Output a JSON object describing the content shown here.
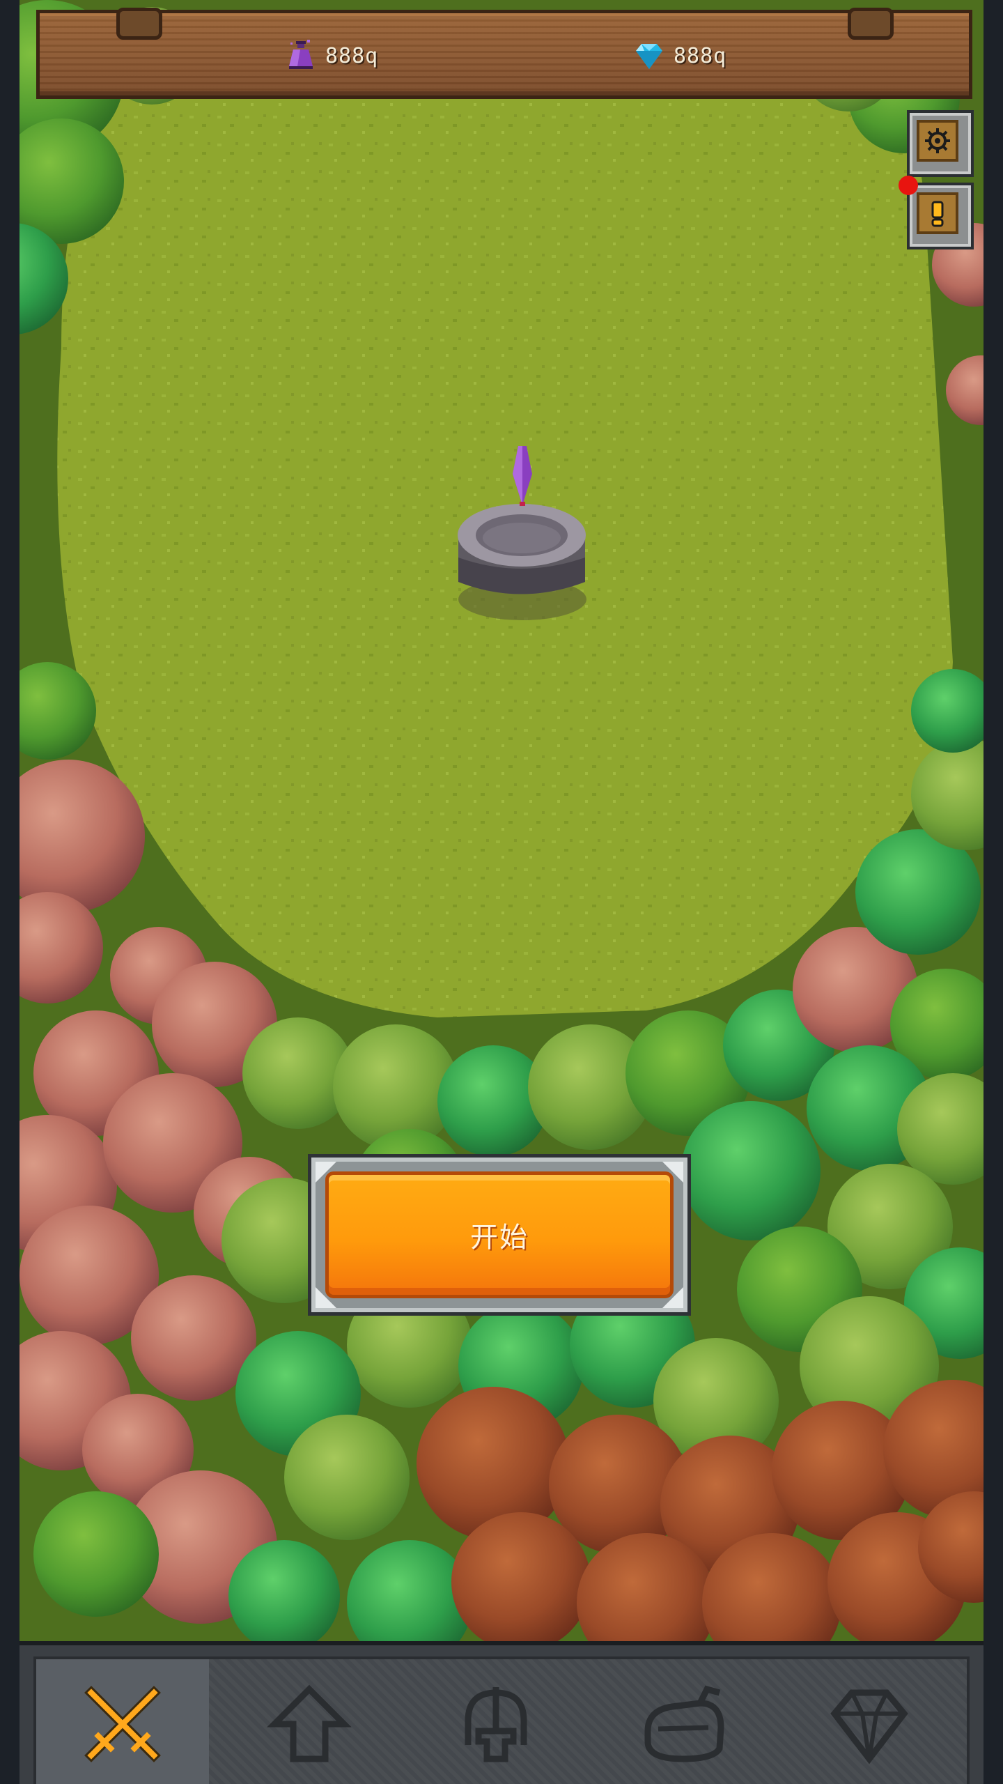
{
  "hud": {
    "potion": {
      "icon": "purple-potion-icon",
      "amount": "888q"
    },
    "gem": {
      "icon": "blue-diamond-icon",
      "amount": "888q"
    }
  },
  "side_buttons": [
    {
      "name": "settings-button",
      "icon": "gear-icon"
    },
    {
      "name": "notice-button",
      "icon": "exclamation-icon",
      "has_notification": true
    }
  ],
  "start_button": {
    "label": "开始"
  },
  "bottom_nav": {
    "items": [
      {
        "name": "nav-battle",
        "icon": "crossed-swords-icon",
        "active": true
      },
      {
        "name": "nav-upgrade",
        "icon": "up-arrow-icon",
        "active": false
      },
      {
        "name": "nav-hero",
        "icon": "helmet-icon",
        "active": false
      },
      {
        "name": "nav-inventory",
        "icon": "bag-icon",
        "active": false
      },
      {
        "name": "nav-shop",
        "icon": "diamond-outline-icon",
        "active": false
      }
    ]
  },
  "colors": {
    "grass": "#8ca52c",
    "button_orange": "#ff9a0c",
    "notification_red": "#e8140f",
    "active_icon": "#ffa81c"
  }
}
